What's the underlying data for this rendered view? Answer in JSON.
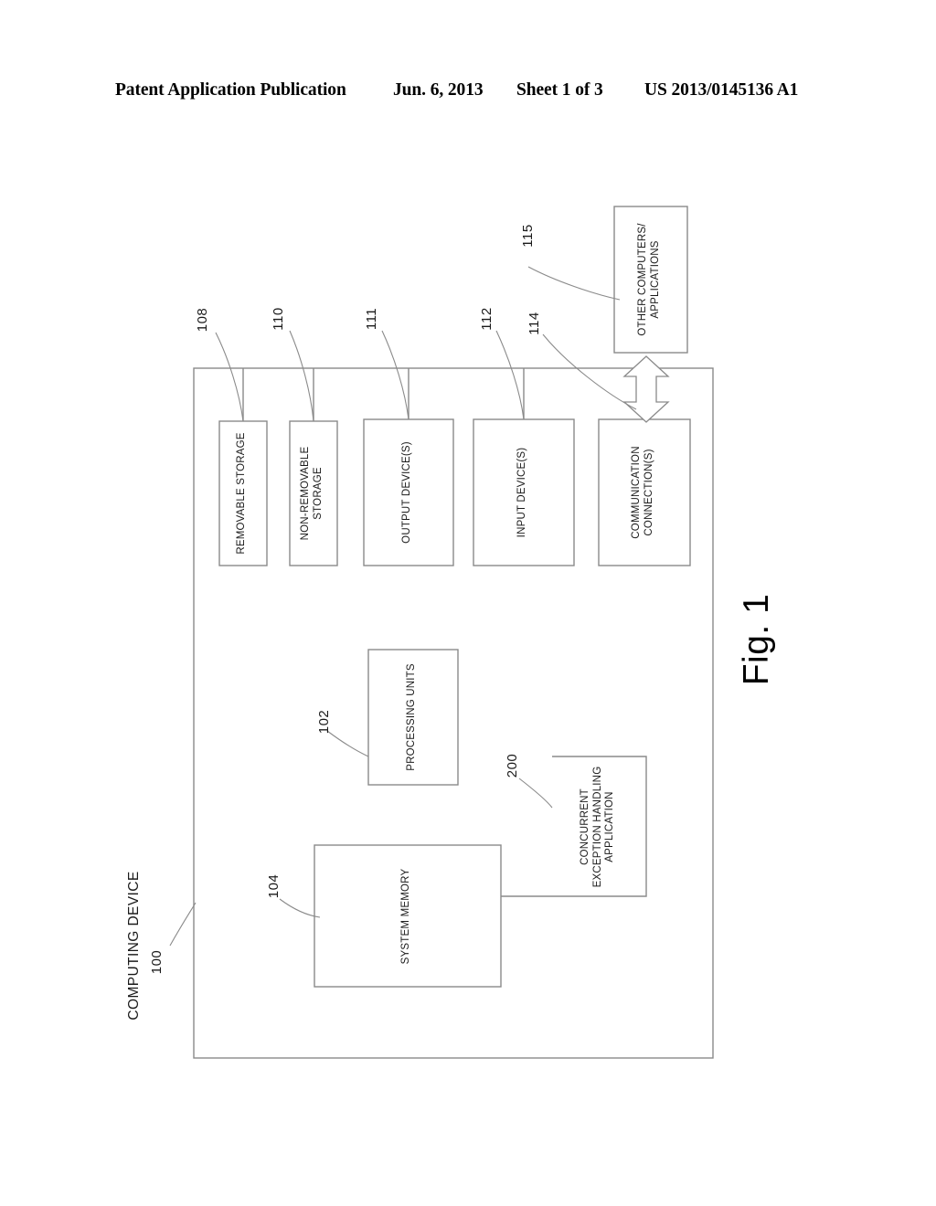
{
  "header": {
    "publication": "Patent Application Publication",
    "date": "Jun. 6, 2013",
    "sheet": "Sheet 1 of 3",
    "patent_number": "US 2013/0145136 A1"
  },
  "figure": {
    "caption": "Fig. 1",
    "outer_box_label": "COMPUTING DEVICE",
    "outer_box_ref": "100",
    "boxes": [
      {
        "id": "removable-storage",
        "label": "REMOVABLE STORAGE",
        "ref": "108"
      },
      {
        "id": "non-removable-storage",
        "label": "NON-REMOVABLE\nSTORAGE",
        "ref": "110"
      },
      {
        "id": "output-devices",
        "label": "OUTPUT DEVICE(S)",
        "ref": "111"
      },
      {
        "id": "input-devices",
        "label": "INPUT DEVICE(S)",
        "ref": "112"
      },
      {
        "id": "communication-connections",
        "label": "COMMUNICATION\nCONNECTION(S)",
        "ref": "114"
      },
      {
        "id": "processing-units",
        "label": "PROCESSING UNITS",
        "ref": "102"
      },
      {
        "id": "system-memory",
        "label": "SYSTEM MEMORY",
        "ref": "104"
      },
      {
        "id": "concurrent-exception-handling-application",
        "label": "CONCURRENT\nEXCEPTION HANDLING\nAPPLICATION",
        "ref": "200"
      },
      {
        "id": "other-computers",
        "label": "OTHER COMPUTERS/\nAPPLICATIONS",
        "ref": "115"
      }
    ],
    "refs": {
      "computing_device": "100",
      "processing_units": "102",
      "system_memory": "104",
      "removable_storage": "108",
      "non_removable_storage": "110",
      "output_devices": "111",
      "input_devices": "112",
      "communication_connections": "114",
      "other_computers": "115",
      "concurrent_exception_handling_application": "200"
    },
    "labels": {
      "removable_storage": "REMOVABLE STORAGE",
      "non_removable_storage": "NON-REMOVABLE\nSTORAGE",
      "output_devices": "OUTPUT DEVICE(S)",
      "input_devices": "INPUT DEVICE(S)",
      "communication_connections": "COMMUNICATION\nCONNECTION(S)",
      "processing_units": "PROCESSING UNITS",
      "system_memory": "SYSTEM MEMORY",
      "concurrent_exception_handling_application": "CONCURRENT\nEXCEPTION HANDLING\nAPPLICATION",
      "other_computers": "OTHER COMPUTERS/\nAPPLICATIONS",
      "computing_device": "COMPUTING DEVICE"
    },
    "colors": {
      "line": "#8a8a8a",
      "text": "#1a1a1a",
      "background": "#ffffff"
    }
  }
}
